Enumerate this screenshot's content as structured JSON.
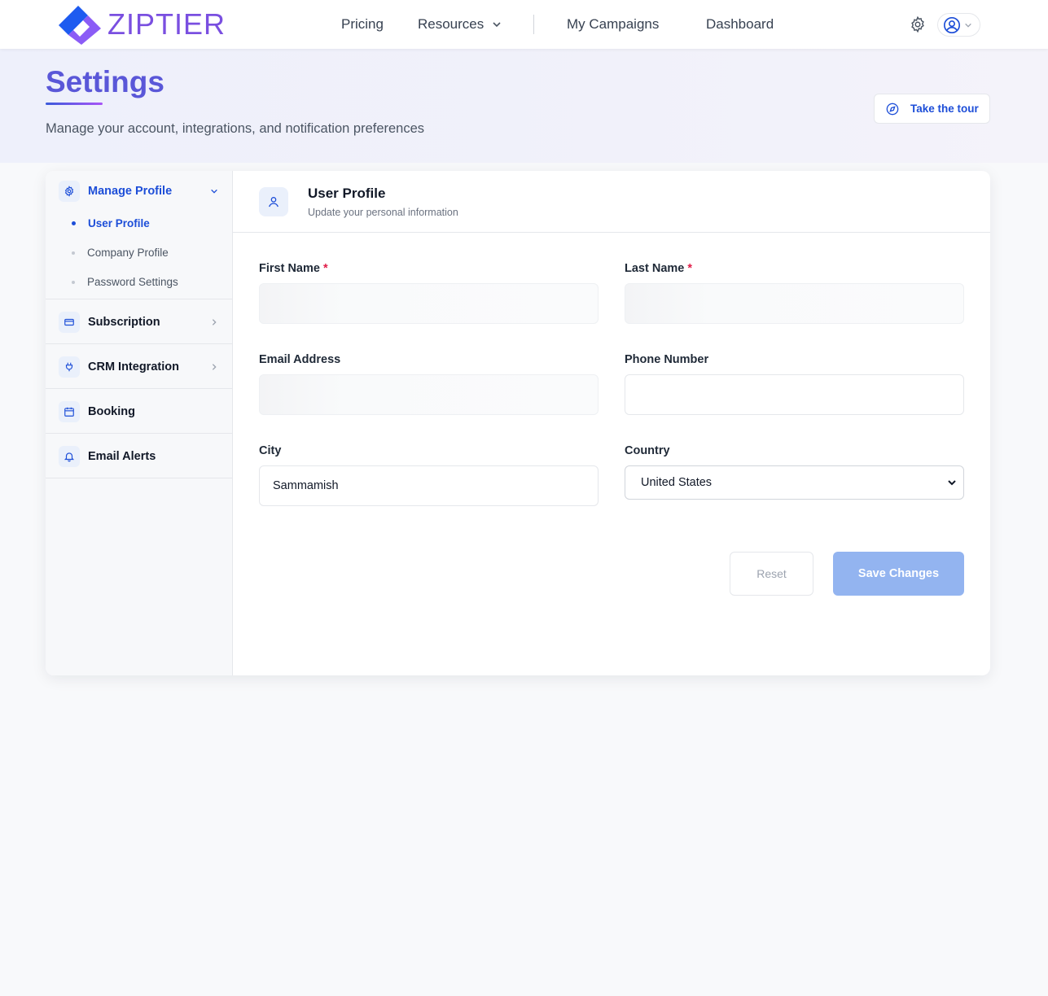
{
  "brand": {
    "name": "ZIPTIER"
  },
  "nav": {
    "pricing": "Pricing",
    "resources": "Resources",
    "campaigns": "My Campaigns",
    "dashboard": "Dashboard"
  },
  "header": {
    "title": "Settings",
    "subtitle": "Manage your account, integrations, and notification preferences",
    "tour_label": "Take the tour"
  },
  "sidebar": {
    "manage_profile": "Manage Profile",
    "sub_items": [
      "User Profile",
      "Company Profile",
      "Password Settings"
    ],
    "subscription": "Subscription",
    "crm": "CRM Integration",
    "booking": "Booking",
    "email_alerts": "Email Alerts"
  },
  "panel": {
    "title": "User Profile",
    "subtitle": "Update your personal information"
  },
  "form": {
    "first_name_label": "First Name",
    "last_name_label": "Last Name",
    "required_mark": "*",
    "email_label": "Email Address",
    "phone_label": "Phone Number",
    "city_label": "City",
    "city_value": "Sammamish",
    "country_label": "Country",
    "country_value": "United States",
    "reset_label": "Reset",
    "save_label": "Save Changes"
  },
  "colors": {
    "accent": "#1d4ed8",
    "title": "#5a57d8",
    "save_button": "#93b4f0",
    "required": "#e11d48"
  }
}
